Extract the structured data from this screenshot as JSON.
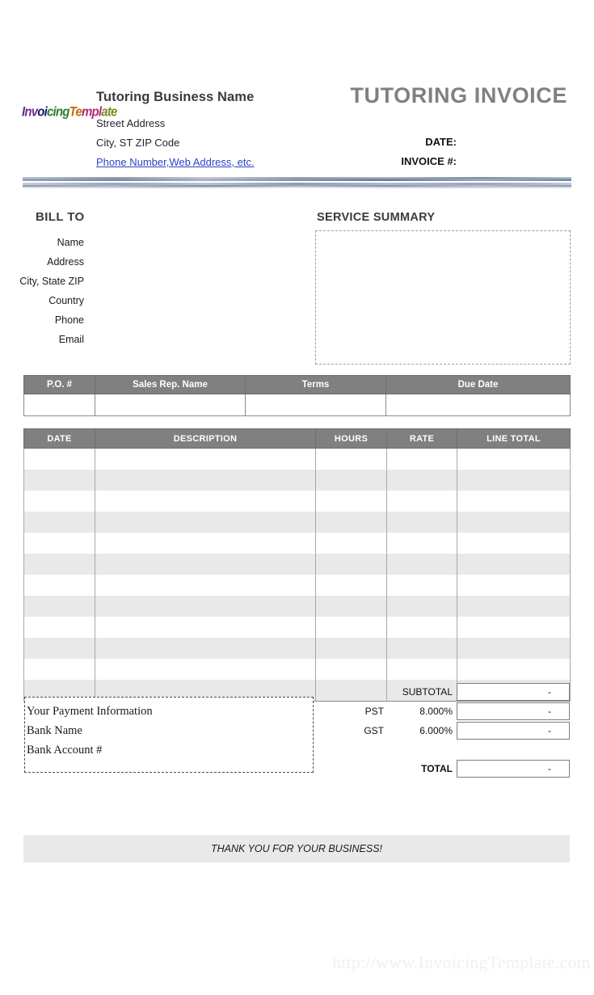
{
  "document": {
    "title": "TUTORING INVOICE",
    "watermark": "http://www.InvoicingTemplate.com"
  },
  "logo": {
    "parts": [
      {
        "text": "Inv",
        "color": "#6c2a86"
      },
      {
        "text": "oi",
        "color": "#1a1a6e"
      },
      {
        "text": "cing",
        "color": "#2f7d2f"
      },
      {
        "text": "Te",
        "color": "#c46b00"
      },
      {
        "text": "mpl",
        "color": "#b02a7a"
      },
      {
        "text": "ate",
        "color": "#7a8a1c"
      }
    ],
    "full_text": "InvoicingTemplate"
  },
  "company": {
    "name": "Tutoring Business Name",
    "street": "Street Address",
    "city_zip": "City, ST  ZIP Code",
    "contact_link": "Phone Number,Web Address, etc."
  },
  "header_fields": {
    "date_label": "DATE:",
    "invoice_no_label": "INVOICE #:",
    "date_value": "",
    "invoice_no_value": ""
  },
  "bill_to": {
    "title": "BILL TO",
    "rows": [
      {
        "label": "Name",
        "value": ""
      },
      {
        "label": "Address",
        "value": ""
      },
      {
        "label": "City, State ZIP",
        "value": ""
      },
      {
        "label": "Country",
        "value": ""
      },
      {
        "label": "Phone",
        "value": ""
      },
      {
        "label": "Email",
        "value": ""
      }
    ]
  },
  "service_summary": {
    "title": "SERVICE SUMMARY",
    "content": ""
  },
  "po_table": {
    "headers": [
      "P.O. #",
      "Sales Rep. Name",
      "Terms",
      "Due Date"
    ],
    "row": [
      "",
      "",
      "",
      ""
    ]
  },
  "items_table": {
    "headers": [
      "DATE",
      "DESCRIPTION",
      "HOURS",
      "RATE",
      "LINE TOTAL"
    ],
    "rows": [
      [
        "",
        "",
        "",
        "",
        ""
      ],
      [
        "",
        "",
        "",
        "",
        ""
      ],
      [
        "",
        "",
        "",
        "",
        ""
      ],
      [
        "",
        "",
        "",
        "",
        ""
      ],
      [
        "",
        "",
        "",
        "",
        ""
      ],
      [
        "",
        "",
        "",
        "",
        ""
      ],
      [
        "",
        "",
        "",
        "",
        ""
      ],
      [
        "",
        "",
        "",
        "",
        ""
      ],
      [
        "",
        "",
        "",
        "",
        ""
      ],
      [
        "",
        "",
        "",
        "",
        ""
      ],
      [
        "",
        "",
        "",
        "",
        ""
      ],
      [
        "",
        "",
        "",
        "",
        ""
      ]
    ]
  },
  "totals": {
    "subtotal_label": "SUBTOTAL",
    "subtotal_value": "-",
    "tax1_name": "PST",
    "tax1_rate": "8.000%",
    "tax1_value": "-",
    "tax2_name": "GST",
    "tax2_rate": "6.000%",
    "tax2_value": "-",
    "total_label": "TOTAL",
    "total_value": "-"
  },
  "payment": {
    "line1": "Your Payment Information",
    "line2": "Bank Name",
    "line3": "Bank Account #"
  },
  "footer": {
    "thank_you": "THANK YOU FOR YOUR BUSINESS!"
  },
  "colors": {
    "header_gray": "#808080",
    "stripe_gray": "#e9e9e9",
    "title_gray": "#808080",
    "link_blue": "#2b43c8"
  }
}
